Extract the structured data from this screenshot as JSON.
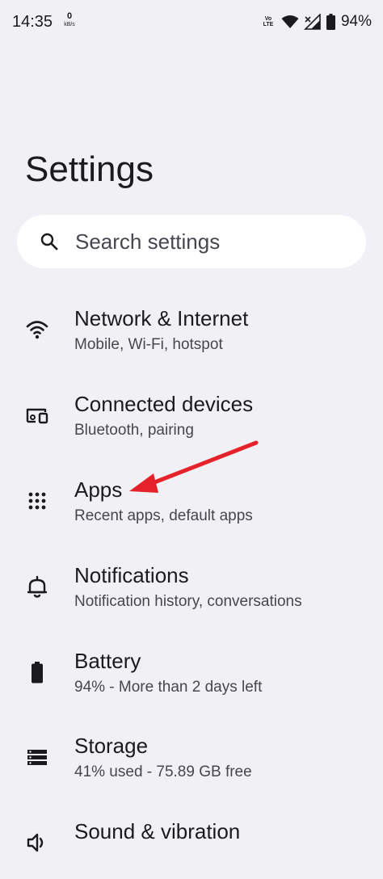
{
  "status_bar": {
    "time": "14:35",
    "net_speed_value": "0",
    "net_speed_unit": "kB/s",
    "volte_top": "Vo",
    "volte_bottom": "LTE",
    "battery": "94%"
  },
  "header": {
    "title": "Settings"
  },
  "search": {
    "placeholder": "Search settings"
  },
  "settings_items": [
    {
      "title": "Network & Internet",
      "subtitle": "Mobile, Wi-Fi, hotspot",
      "icon": "wifi-icon"
    },
    {
      "title": "Connected devices",
      "subtitle": "Bluetooth, pairing",
      "icon": "connected-devices-icon"
    },
    {
      "title": "Apps",
      "subtitle": "Recent apps, default apps",
      "icon": "apps-grid-icon"
    },
    {
      "title": "Notifications",
      "subtitle": "Notification history, conversations",
      "icon": "bell-icon"
    },
    {
      "title": "Battery",
      "subtitle": "94% - More than 2 days left",
      "icon": "battery-icon"
    },
    {
      "title": "Storage",
      "subtitle": "41% used - 75.89 GB free",
      "icon": "storage-icon"
    },
    {
      "title": "Sound & vibration",
      "subtitle": "",
      "icon": "volume-icon"
    }
  ],
  "annotation": {
    "color": "#e5222a"
  }
}
